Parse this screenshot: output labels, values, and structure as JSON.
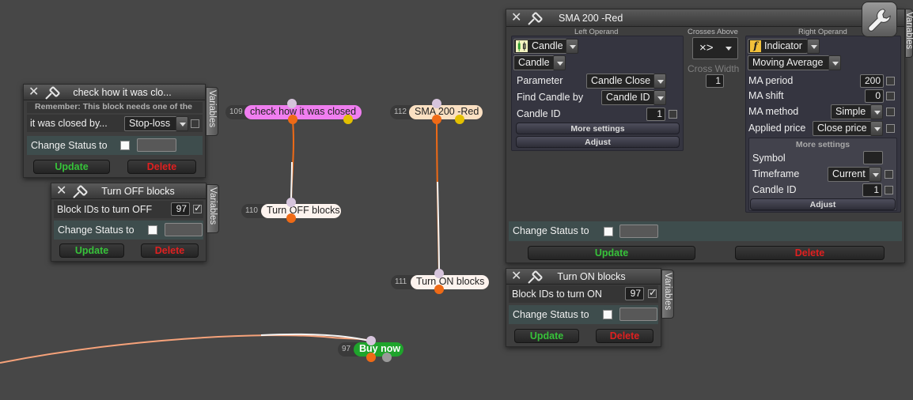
{
  "colors": {
    "background": "#474747",
    "wire_orange": "#ef6a16",
    "wire_white": "#f5f5f5",
    "wire_salmon": "#f6a27a",
    "update_green": "#37c23a",
    "delete_red": "#e02020",
    "node_pink": "#f07ef0",
    "node_peach": "#fbe0c2",
    "node_white": "#fdf3ee",
    "node_green": "#1fa42c"
  },
  "icons": {
    "close": "close-x-icon",
    "pin": "pushpin-icon",
    "candle": "candlestick-icon",
    "indicator": "function-icon",
    "tools": "wrench-icon"
  },
  "nodes": [
    {
      "id": "109",
      "label": "check how it was closed"
    },
    {
      "id": "112",
      "label": "SMA 200 -Red"
    },
    {
      "id": "110",
      "label": "Turn OFF blocks"
    },
    {
      "id": "111",
      "label": "Turn ON blocks"
    },
    {
      "id": "97",
      "label": "Buy now"
    }
  ],
  "common": {
    "variables_tab": "Variables",
    "change_status_label": "Change Status to",
    "update_label": "Update",
    "delete_label": "Delete"
  },
  "panel_check": {
    "title": "check how it was clo...",
    "remember_text": "Remember: This block needs one of the",
    "field_label": "it was closed by...",
    "field_value": "Stop-loss"
  },
  "panel_off": {
    "title": "Turn OFF blocks",
    "ids_label": "Block IDs to turn OFF",
    "ids_value": "97"
  },
  "panel_on": {
    "title": "Turn ON blocks",
    "ids_label": "Block IDs to turn ON",
    "ids_value": "97"
  },
  "panel_sma": {
    "title": "SMA 200 -Red",
    "left_operand_header": "Left Operand",
    "crosses_header": "Crosses Above",
    "right_operand_header": "Right Operand",
    "left": {
      "type_value": "Candle",
      "subtype_value": "Candle",
      "parameter_label": "Parameter",
      "parameter_value": "Candle Close",
      "find_label": "Find Candle by",
      "find_value": "Candle ID",
      "candle_id_label": "Candle ID",
      "candle_id_value": "1",
      "more_settings": "More settings",
      "adjust": "Adjust"
    },
    "middle": {
      "operator_value": "×>",
      "cross_width_label": "Cross Width",
      "cross_width_value": "1"
    },
    "right": {
      "type_value": "Indicator",
      "subtype_value": "Moving Average",
      "ma_period_label": "MA period",
      "ma_period_value": "200",
      "ma_shift_label": "MA shift",
      "ma_shift_value": "0",
      "ma_method_label": "MA method",
      "ma_method_value": "Simple",
      "applied_price_label": "Applied price",
      "applied_price_value": "Close price",
      "more_settings": "More settings",
      "symbol_label": "Symbol",
      "symbol_value": "",
      "timeframe_label": "Timeframe",
      "timeframe_value": "Current",
      "candle_id_label": "Candle ID",
      "candle_id_value": "1",
      "adjust": "Adjust"
    }
  }
}
